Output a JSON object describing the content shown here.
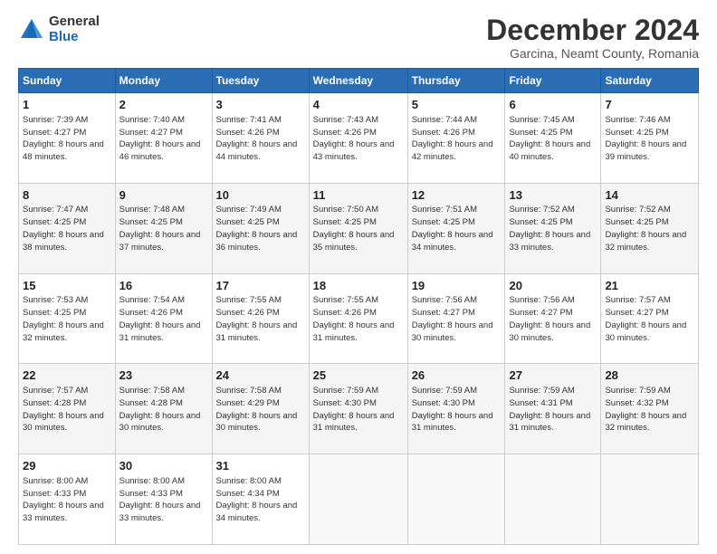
{
  "logo": {
    "general": "General",
    "blue": "Blue"
  },
  "title": "December 2024",
  "location": "Garcina, Neamt County, Romania",
  "days_of_week": [
    "Sunday",
    "Monday",
    "Tuesday",
    "Wednesday",
    "Thursday",
    "Friday",
    "Saturday"
  ],
  "weeks": [
    [
      {
        "day": 1,
        "sunrise": "7:39 AM",
        "sunset": "4:27 PM",
        "daylight": "8 hours and 48 minutes."
      },
      {
        "day": 2,
        "sunrise": "7:40 AM",
        "sunset": "4:27 PM",
        "daylight": "8 hours and 46 minutes."
      },
      {
        "day": 3,
        "sunrise": "7:41 AM",
        "sunset": "4:26 PM",
        "daylight": "8 hours and 44 minutes."
      },
      {
        "day": 4,
        "sunrise": "7:43 AM",
        "sunset": "4:26 PM",
        "daylight": "8 hours and 43 minutes."
      },
      {
        "day": 5,
        "sunrise": "7:44 AM",
        "sunset": "4:26 PM",
        "daylight": "8 hours and 42 minutes."
      },
      {
        "day": 6,
        "sunrise": "7:45 AM",
        "sunset": "4:25 PM",
        "daylight": "8 hours and 40 minutes."
      },
      {
        "day": 7,
        "sunrise": "7:46 AM",
        "sunset": "4:25 PM",
        "daylight": "8 hours and 39 minutes."
      }
    ],
    [
      {
        "day": 8,
        "sunrise": "7:47 AM",
        "sunset": "4:25 PM",
        "daylight": "8 hours and 38 minutes."
      },
      {
        "day": 9,
        "sunrise": "7:48 AM",
        "sunset": "4:25 PM",
        "daylight": "8 hours and 37 minutes."
      },
      {
        "day": 10,
        "sunrise": "7:49 AM",
        "sunset": "4:25 PM",
        "daylight": "8 hours and 36 minutes."
      },
      {
        "day": 11,
        "sunrise": "7:50 AM",
        "sunset": "4:25 PM",
        "daylight": "8 hours and 35 minutes."
      },
      {
        "day": 12,
        "sunrise": "7:51 AM",
        "sunset": "4:25 PM",
        "daylight": "8 hours and 34 minutes."
      },
      {
        "day": 13,
        "sunrise": "7:52 AM",
        "sunset": "4:25 PM",
        "daylight": "8 hours and 33 minutes."
      },
      {
        "day": 14,
        "sunrise": "7:52 AM",
        "sunset": "4:25 PM",
        "daylight": "8 hours and 32 minutes."
      }
    ],
    [
      {
        "day": 15,
        "sunrise": "7:53 AM",
        "sunset": "4:25 PM",
        "daylight": "8 hours and 32 minutes."
      },
      {
        "day": 16,
        "sunrise": "7:54 AM",
        "sunset": "4:26 PM",
        "daylight": "8 hours and 31 minutes."
      },
      {
        "day": 17,
        "sunrise": "7:55 AM",
        "sunset": "4:26 PM",
        "daylight": "8 hours and 31 minutes."
      },
      {
        "day": 18,
        "sunrise": "7:55 AM",
        "sunset": "4:26 PM",
        "daylight": "8 hours and 31 minutes."
      },
      {
        "day": 19,
        "sunrise": "7:56 AM",
        "sunset": "4:27 PM",
        "daylight": "8 hours and 30 minutes."
      },
      {
        "day": 20,
        "sunrise": "7:56 AM",
        "sunset": "4:27 PM",
        "daylight": "8 hours and 30 minutes."
      },
      {
        "day": 21,
        "sunrise": "7:57 AM",
        "sunset": "4:27 PM",
        "daylight": "8 hours and 30 minutes."
      }
    ],
    [
      {
        "day": 22,
        "sunrise": "7:57 AM",
        "sunset": "4:28 PM",
        "daylight": "8 hours and 30 minutes."
      },
      {
        "day": 23,
        "sunrise": "7:58 AM",
        "sunset": "4:28 PM",
        "daylight": "8 hours and 30 minutes."
      },
      {
        "day": 24,
        "sunrise": "7:58 AM",
        "sunset": "4:29 PM",
        "daylight": "8 hours and 30 minutes."
      },
      {
        "day": 25,
        "sunrise": "7:59 AM",
        "sunset": "4:30 PM",
        "daylight": "8 hours and 31 minutes."
      },
      {
        "day": 26,
        "sunrise": "7:59 AM",
        "sunset": "4:30 PM",
        "daylight": "8 hours and 31 minutes."
      },
      {
        "day": 27,
        "sunrise": "7:59 AM",
        "sunset": "4:31 PM",
        "daylight": "8 hours and 31 minutes."
      },
      {
        "day": 28,
        "sunrise": "7:59 AM",
        "sunset": "4:32 PM",
        "daylight": "8 hours and 32 minutes."
      }
    ],
    [
      {
        "day": 29,
        "sunrise": "8:00 AM",
        "sunset": "4:33 PM",
        "daylight": "8 hours and 33 minutes."
      },
      {
        "day": 30,
        "sunrise": "8:00 AM",
        "sunset": "4:33 PM",
        "daylight": "8 hours and 33 minutes."
      },
      {
        "day": 31,
        "sunrise": "8:00 AM",
        "sunset": "4:34 PM",
        "daylight": "8 hours and 34 minutes."
      },
      null,
      null,
      null,
      null
    ]
  ]
}
